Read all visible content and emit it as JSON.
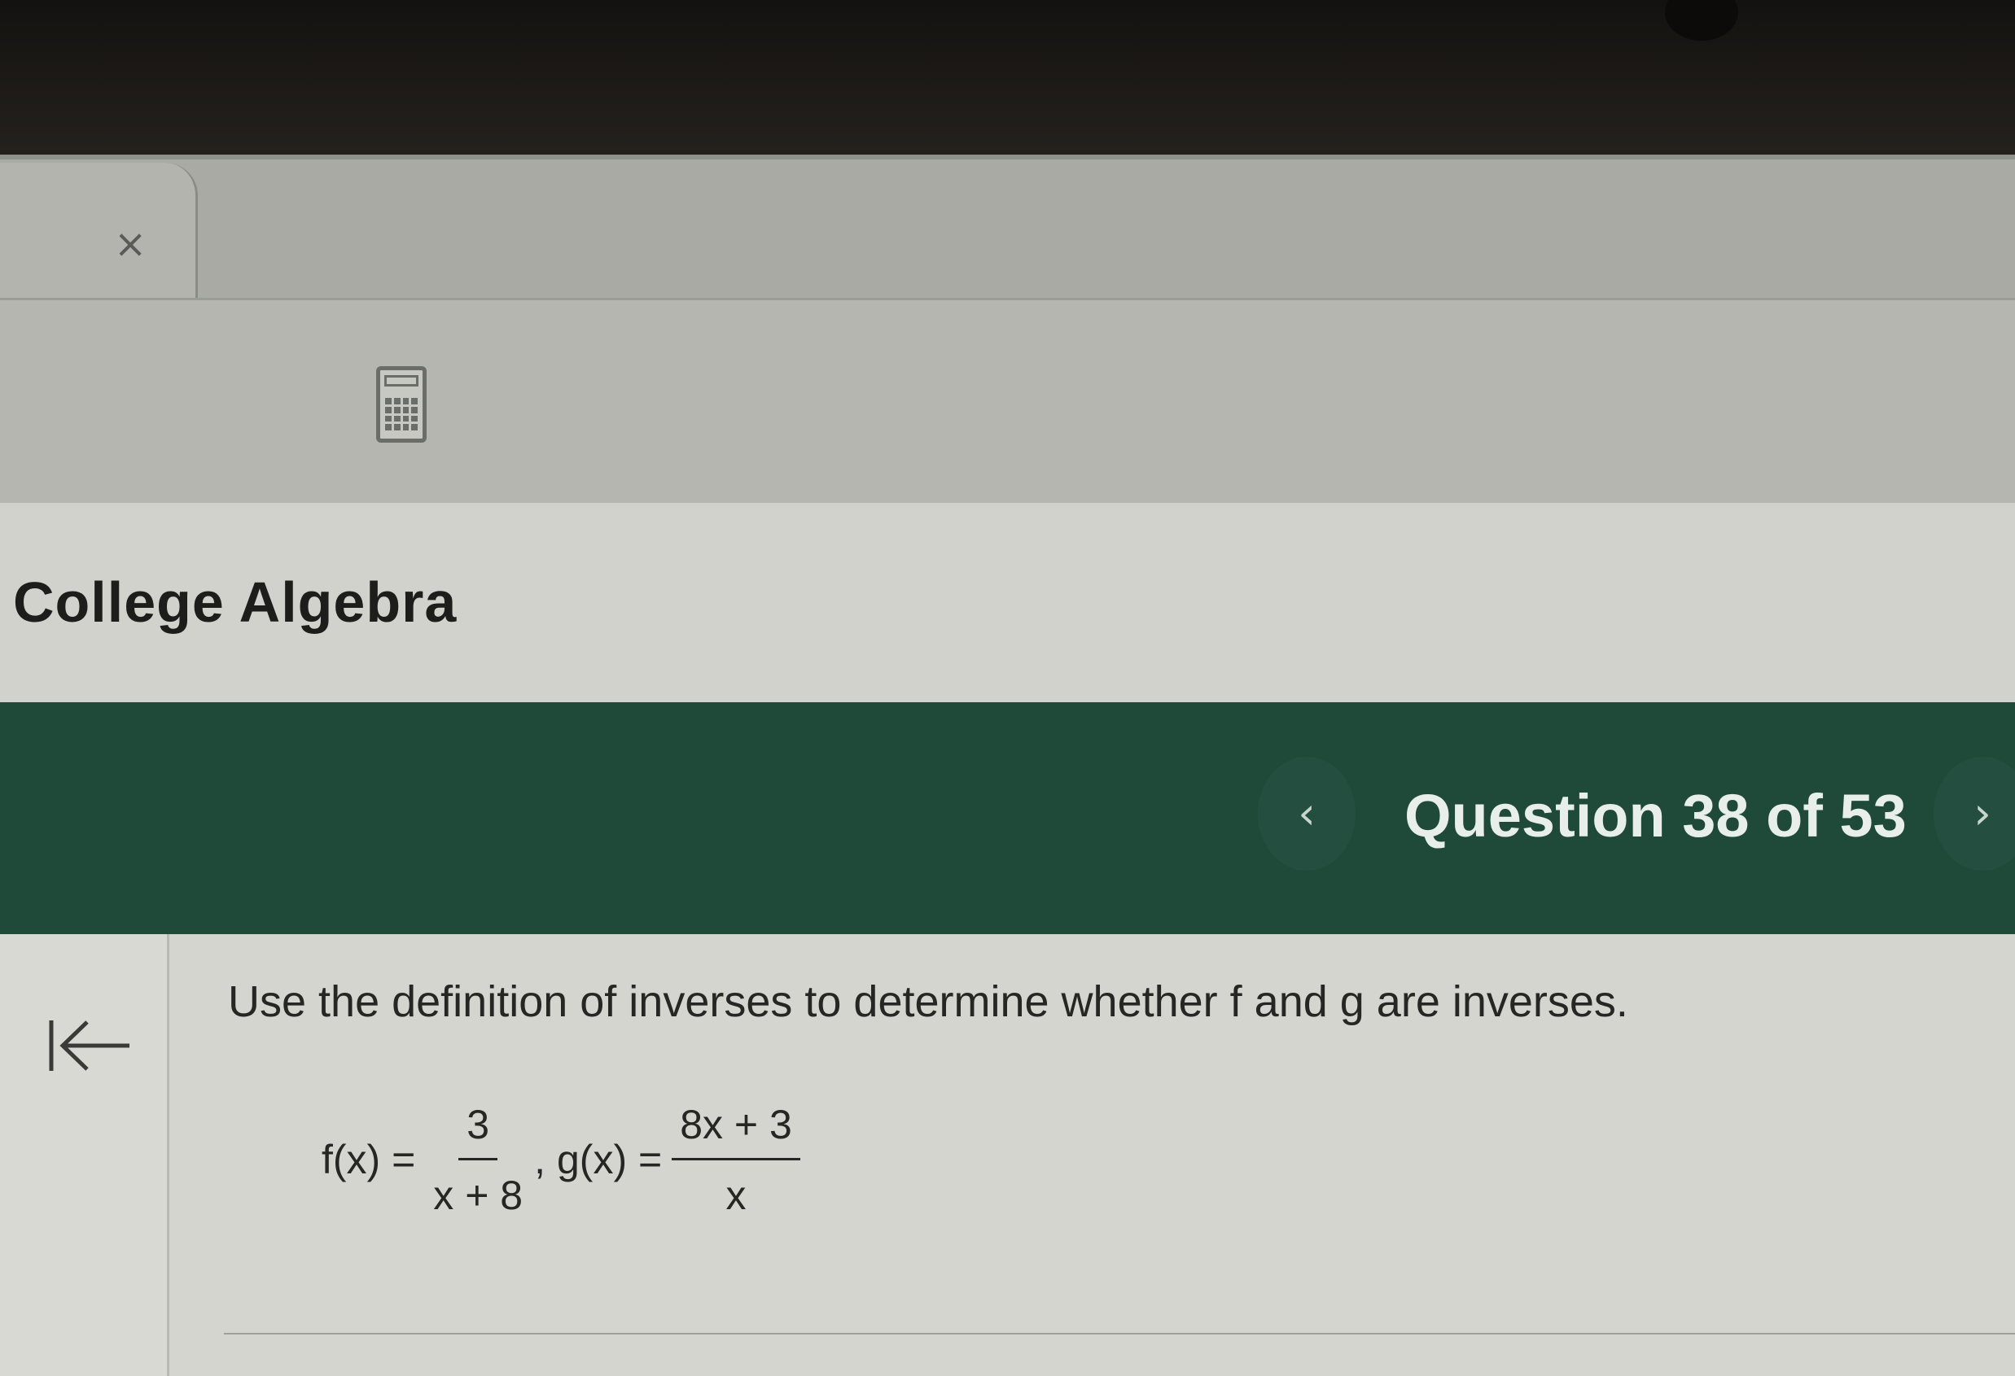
{
  "tab": {
    "close_glyph": "×"
  },
  "toolbar": {
    "calculator_icon": "calculator-icon"
  },
  "course": {
    "title": "College Algebra"
  },
  "navigation": {
    "prev_glyph": "‹",
    "counter": "Question 38 of 53",
    "next_glyph": "›"
  },
  "question": {
    "prompt": "Use the definition of inverses to determine whether f and g are inverses.",
    "f_label": "f(x) =",
    "f_numerator": "3",
    "f_denominator": "x + 8",
    "separator": ",",
    "g_label": "g(x) =",
    "g_numerator": "8x + 3",
    "g_denominator": "x"
  },
  "colors": {
    "nav_band": "#1f4a3a",
    "page_background": "#d4d5cf"
  }
}
